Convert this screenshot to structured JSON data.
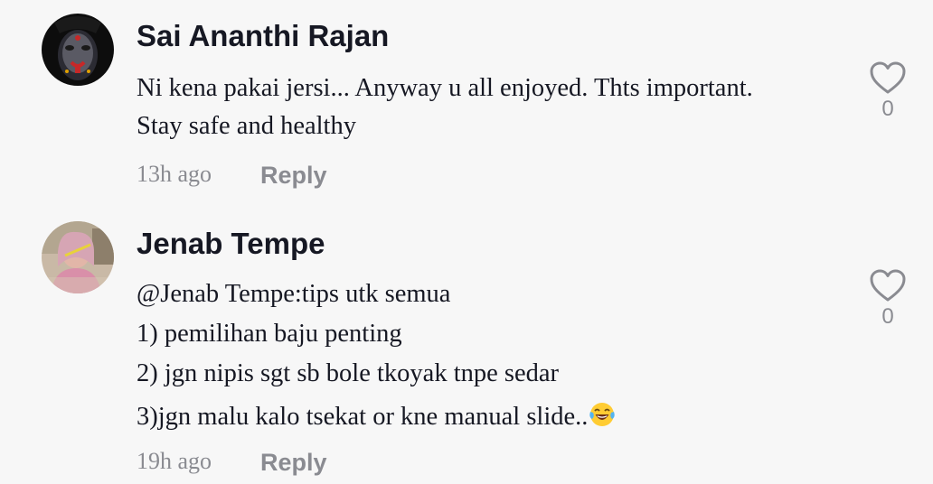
{
  "comments": [
    {
      "username": "Sai Ananthi Rajan",
      "lines": [
        "Ni kena pakai jersi... Anyway u all enjoyed. Thts important.",
        "Stay safe and healthy"
      ],
      "time": "13h ago",
      "reply_label": "Reply",
      "like_count": "0",
      "avatar_icon": "user-avatar-icon",
      "like_icon": "heart-outline-icon"
    },
    {
      "username": "Jenab Tempe",
      "lines": [
        "@Jenab Tempe:tips utk semua",
        "1) pemilihan baju penting",
        "2) jgn nipis sgt sb bole tkoyak tnpe sedar",
        "3)jgn malu kalo tsekat or kne manual slide.."
      ],
      "trailing_emoji": "laughing-tears-emoji",
      "time": "19h ago",
      "reply_label": "Reply",
      "like_count": "0",
      "avatar_icon": "user-avatar-icon",
      "like_icon": "heart-outline-icon"
    }
  ],
  "colors": {
    "background": "#f7f7f7",
    "text_primary": "#161823",
    "text_secondary": "#8a8b91"
  }
}
